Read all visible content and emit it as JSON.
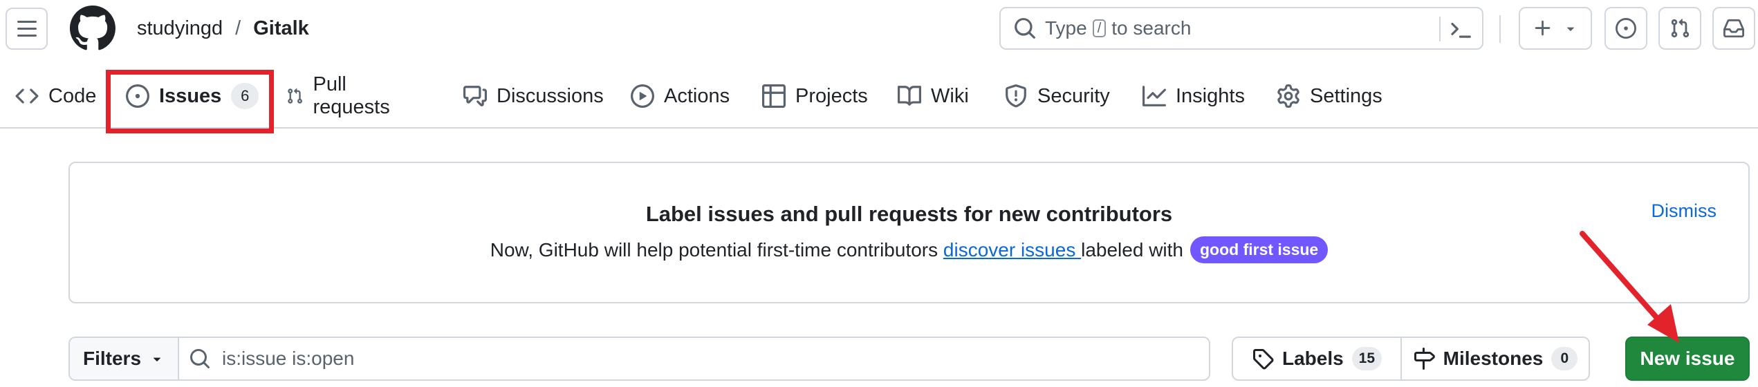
{
  "header": {
    "owner": "studyingd",
    "separator": "/",
    "repo": "Gitalk",
    "search_prefix": "Type",
    "search_key": "/",
    "search_suffix": "to search"
  },
  "tabs": [
    {
      "label": "Code",
      "icon": "code-icon"
    },
    {
      "label": "Issues",
      "count": "6",
      "icon": "issue-opened-icon",
      "selected": true
    },
    {
      "label": "Pull requests",
      "icon": "git-pull-request-icon"
    },
    {
      "label": "Discussions",
      "icon": "comment-discussion-icon"
    },
    {
      "label": "Actions",
      "icon": "play-icon"
    },
    {
      "label": "Projects",
      "icon": "table-icon"
    },
    {
      "label": "Wiki",
      "icon": "book-icon"
    },
    {
      "label": "Security",
      "icon": "shield-icon"
    },
    {
      "label": "Insights",
      "icon": "graph-icon"
    },
    {
      "label": "Settings",
      "icon": "gear-icon"
    }
  ],
  "banner": {
    "title": "Label issues and pull requests for new contributors",
    "desc_before": "Now, GitHub will help potential first-time contributors ",
    "link": "discover issues ",
    "desc_after": "labeled with",
    "label": "good first issue",
    "dismiss": "Dismiss"
  },
  "filters": {
    "button": "Filters",
    "query": "is:issue is:open"
  },
  "labels": {
    "label": "Labels",
    "count": "15"
  },
  "milestones": {
    "label": "Milestones",
    "count": "0"
  },
  "new_issue": "New issue",
  "colors": {
    "accent_link": "#0969da",
    "primary_button": "#1f883d",
    "annotation_red": "#e3232c",
    "good_first_issue": "#7057ff"
  }
}
